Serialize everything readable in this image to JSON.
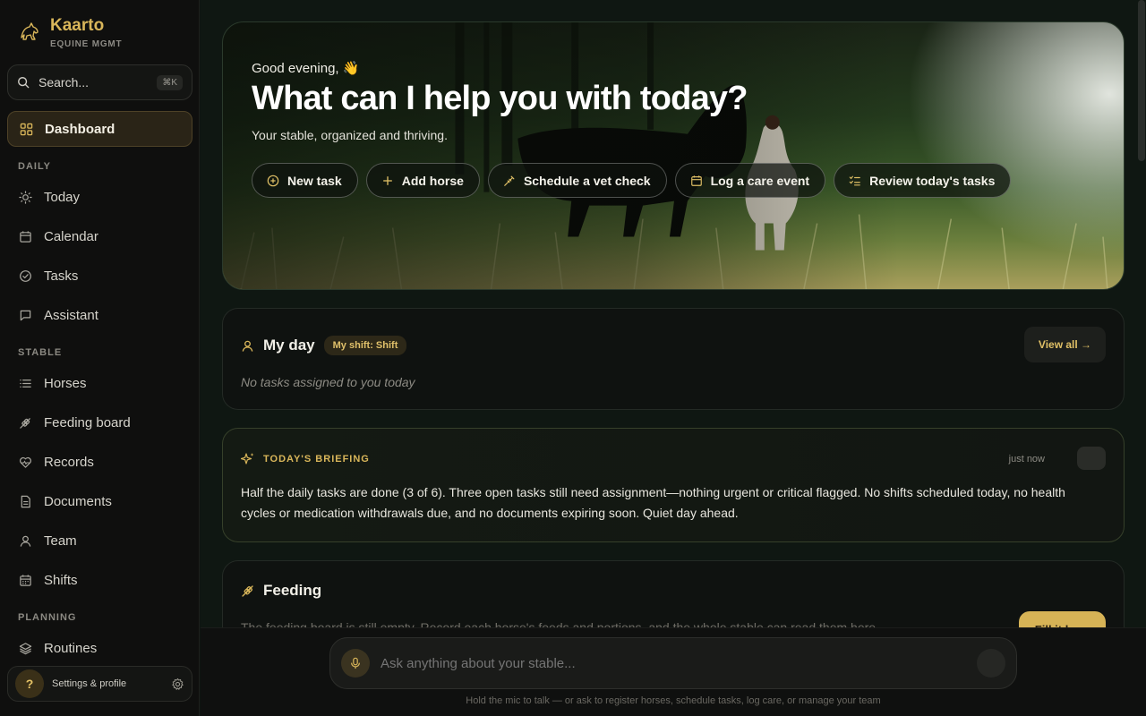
{
  "brand": {
    "name": "Kaarto",
    "subtitle": "EQUINE MGMT"
  },
  "search": {
    "placeholder": "Search...",
    "shortcut": "⌘K"
  },
  "sidebar": {
    "dashboard": "Dashboard",
    "sections": {
      "daily": "DAILY",
      "stable": "STABLE",
      "planning": "PLANNING"
    },
    "items": {
      "today": "Today",
      "calendar": "Calendar",
      "tasks": "Tasks",
      "assistant": "Assistant",
      "horses": "Horses",
      "feeding_board": "Feeding board",
      "records": "Records",
      "documents": "Documents",
      "team": "Team",
      "shifts": "Shifts",
      "routines": "Routines"
    },
    "profile": {
      "avatar": "?",
      "label": "Settings & profile"
    }
  },
  "hero": {
    "greeting": "Good evening, 👋",
    "headline": "What can I help you with today?",
    "tagline": "Your stable, organized and thriving.",
    "actions": [
      "New task",
      "Add horse",
      "Schedule a vet check",
      "Log a care event",
      "Review today's tasks"
    ]
  },
  "my_day": {
    "title": "My day",
    "shift_badge": "My shift: Shift",
    "view_all": "View all →",
    "empty": "No tasks assigned to you today"
  },
  "briefing": {
    "title": "TODAY'S BRIEFING",
    "time": "just now",
    "text": "Half the daily tasks are done (3 of 6). Three open tasks still need assignment—nothing urgent or critical flagged. No shifts scheduled today, no health cycles or medication withdrawals due, and no documents expiring soon. Quiet day ahead."
  },
  "feeding": {
    "title": "Feeding",
    "text": "The feeding board is still empty. Record each horse's feeds and portions, and the whole stable can read them here.",
    "button": "Fill it here"
  },
  "composer": {
    "placeholder": "Ask anything about your stable...",
    "hint": "Hold the mic to talk — or ask to register horses, schedule tasks, log care, or manage your team"
  },
  "colors": {
    "accent": "#d9b65a",
    "background": "#0f1712",
    "sidebar": "#0f0f0e"
  }
}
